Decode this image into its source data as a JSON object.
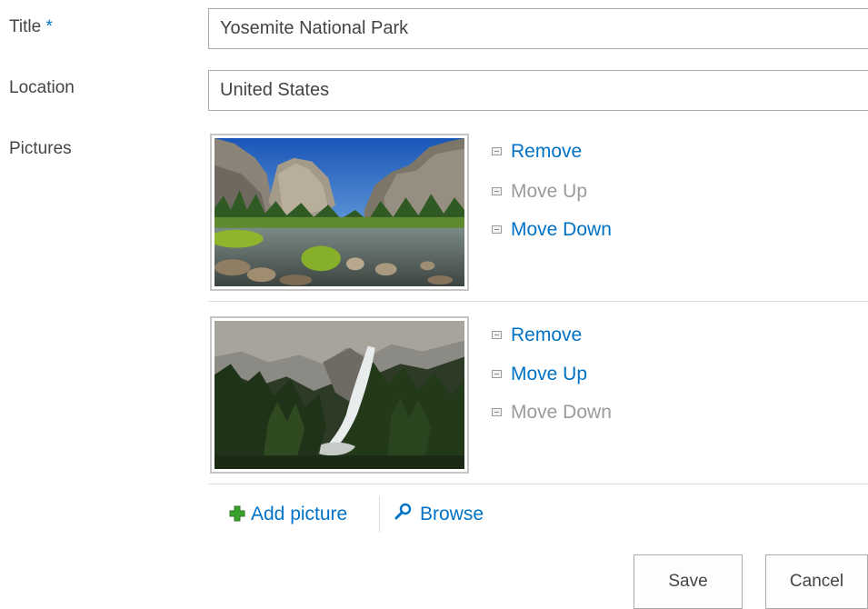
{
  "form": {
    "title_label": "Title",
    "required_marker": "*",
    "title_value": "Yosemite National Park",
    "location_label": "Location",
    "location_value": "United States",
    "pictures_label": "Pictures"
  },
  "pictures": [
    {
      "remove_label": "Remove",
      "move_up_label": "Move Up",
      "move_down_label": "Move Down",
      "move_up_enabled": false,
      "move_down_enabled": true
    },
    {
      "remove_label": "Remove",
      "move_up_label": "Move Up",
      "move_down_label": "Move Down",
      "move_up_enabled": true,
      "move_down_enabled": false
    }
  ],
  "links": {
    "add_picture": "Add picture",
    "browse": "Browse"
  },
  "buttons": {
    "save": "Save",
    "cancel": "Cancel"
  },
  "colors": {
    "link": "#0072c6",
    "disabled": "#9b9b9b",
    "add_icon": "#3aa12c"
  },
  "icons": {
    "add": "plus-icon",
    "browse": "magnifier-icon",
    "action_bullet": "list-bullet-icon"
  }
}
